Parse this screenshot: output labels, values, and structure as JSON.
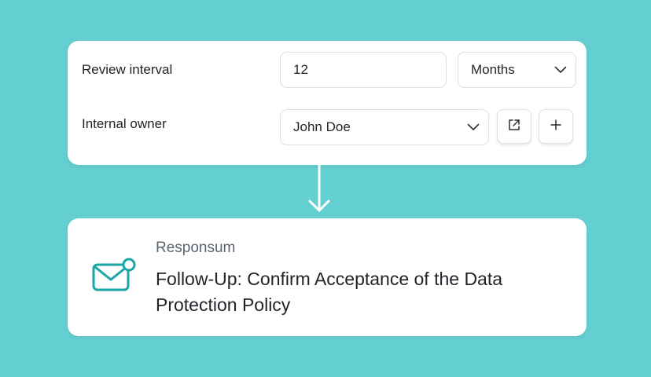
{
  "settings": {
    "review_interval": {
      "label": "Review interval",
      "value": "12",
      "unit": "Months"
    },
    "internal_owner": {
      "label": "Internal owner",
      "value": "John Doe"
    }
  },
  "notification": {
    "sender": "Responsum",
    "subject": "Follow-Up: Confirm Acceptance of the Data Protection Policy"
  },
  "icons": {
    "unit_dropdown": "chevron-down-icon",
    "owner_dropdown": "chevron-down-icon",
    "open_owner": "external-link-icon",
    "add_owner": "plus-icon",
    "flow": "arrow-down-icon",
    "mail": "mail-notification-icon"
  },
  "colors": {
    "background": "#63cfd1",
    "accent": "#1aa6a8"
  }
}
